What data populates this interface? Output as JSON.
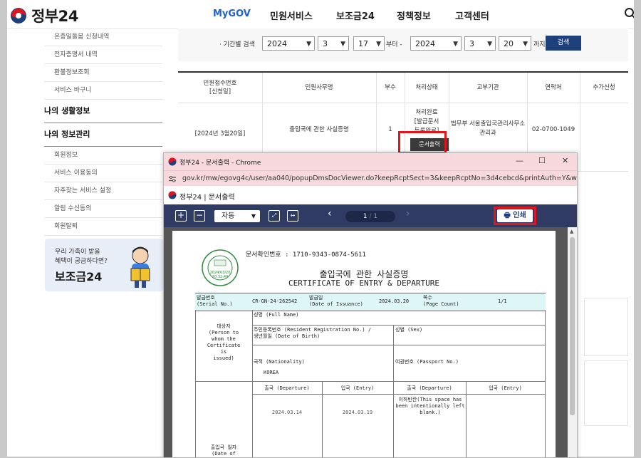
{
  "header": {
    "logo_text": "정부24",
    "nav": [
      "MyGOV",
      "민원서비스",
      "보조금24",
      "정책정보",
      "고객센터"
    ]
  },
  "sidebar": {
    "top_items": [
      "온종일돌봄 신청내역",
      "전자증명서 내역",
      "환불정보조회",
      "서비스 바구니"
    ],
    "section1": "나의 생활정보",
    "section2": "나의 정보관리",
    "bottom_items": [
      "회원정보",
      "서비스 이용동의",
      "자주찾는 서비스 설정",
      "알림 수신동의",
      "회원탈퇴"
    ]
  },
  "promo": {
    "line1": "우리 가족이 받을",
    "line2": "혜택이 궁금하다면?",
    "title": "보조금24"
  },
  "filter": {
    "label": "· 기간별 검색",
    "from_year": "2024",
    "from_month": "3",
    "from_day": "17",
    "from_suffix": "부터 -",
    "to_year": "2024",
    "to_month": "3",
    "to_day": "20",
    "to_suffix": "까지",
    "search_label": "검색"
  },
  "table": {
    "headers": [
      "민원접수번호\n[신청일]",
      "민원사무명",
      "부수",
      "처리상태",
      "교부기관",
      "연락처",
      "추가신청"
    ],
    "row": {
      "date": "[2024년 3월20일]",
      "name": "출입국에 관한 사실증명",
      "count": "1",
      "status": "처리완료\n[발급문서\n등록완료]",
      "agency": "법무부 서울출입국관리사무소\n관리과",
      "phone": "02-0700-1049",
      "doc_button": "문서출력"
    }
  },
  "popup": {
    "window_title": "정부24 - 문서출력 - Chrome",
    "url": "gov.kr/mw/egovg4c/user/aa040/popupDmsDocViewer.do?keepRcptSect=3&keepRcptNo=3d4cebcd&printAuth=Y&w...",
    "app_title": "정부24 | 문서출력",
    "zoom": "자동",
    "page_current": "1",
    "page_total": "1",
    "print_label": "인쇄"
  },
  "certificate": {
    "doc_no": "문서확인번호 : 1710-9343-0874-5611",
    "title_ko": "출입국에 관한 사실증명",
    "title_en": "CERTIFICATE OF ENTRY & DEPARTURE",
    "serial_label": "발급번호\n(Serial No.)",
    "serial_value": "CR-GN-24-262542",
    "issue_label": "발급일\n(Date of Issuance)",
    "issue_value": "2024.03.20",
    "pages_label": "쪽수\n(Page Count)",
    "pages_value": "1/1",
    "subject_label": "대상자\n(Person to\nwhom the\nCertificate\nis\nissued)",
    "name_label": "성명 (Full Name)",
    "rrn_label": "주민등록번호 (Resident Registration No.) /\n생년월일 (Date of Birth)",
    "sex_label": "성별 (Sex)",
    "nationality_label": "국적 (Nationality)",
    "nationality_value": "KOREA",
    "passport_label": "여권번호 (Passport No.)",
    "dep_label": "출국 (Departure)",
    "ent_label": "입국 (Entry)",
    "dep2_label": "출국 (Departure)",
    "ent2_label": "입국 (Entry)",
    "dep_date": "2024.03.14",
    "ent_date": "2024.03.19",
    "blank_note": "이하빈칸(This space has\nbeen intentionally left\nblank.)",
    "dates_label": "출입국 일자\n(Date of",
    "seal_text": "전 결\n2024/03/20\n20:31:49\nKST"
  }
}
